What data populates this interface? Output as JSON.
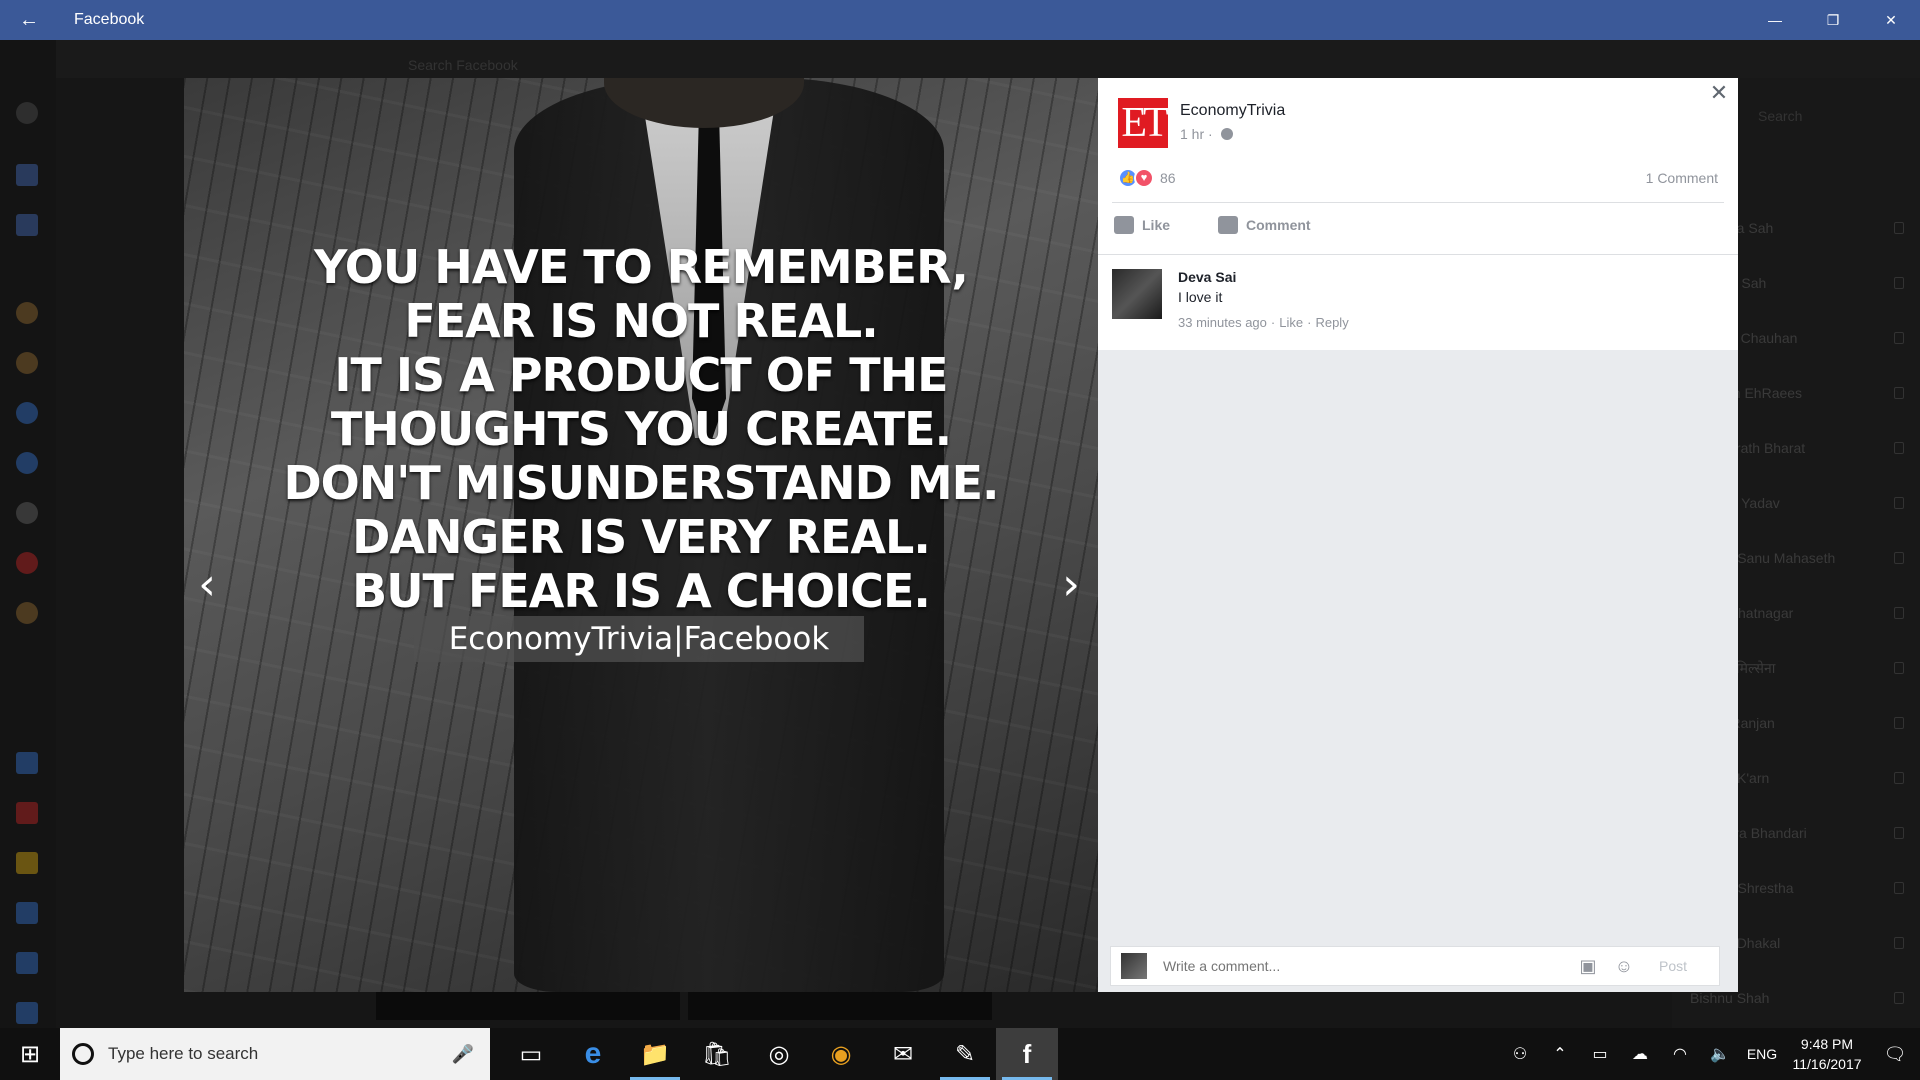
{
  "window": {
    "title": "Facebook",
    "back_glyph": "←",
    "minimize_glyph": "—",
    "restore_glyph": "❐",
    "close_glyph": "✕"
  },
  "background": {
    "search_placeholder": "Search Facebook",
    "right_search": "Search",
    "contacts": [
      "Priyanka Sah",
      "Krishna Sah",
      "Aayush Chauhan",
      "ItsNavin EhRaees",
      "Ah Bharath Bharat",
      "Nishant Yadav",
      "Vikram Sanu Mahaseth",
      "Vibek Bhatnagar",
      "आयुष तिमिल्सेना",
      "Rahul Ranjan",
      "A'Yush K'arn",
      "Rabindra Bhandari",
      "Angela Shrestha",
      "Sachin Dhakal",
      "Bishnu Shah"
    ]
  },
  "viewer": {
    "prev_glyph": "‹",
    "next_glyph": "›",
    "quote_lines": [
      "YOU HAVE TO REMEMBER,",
      "FEAR IS NOT REAL.",
      "IT IS A PRODUCT OF THE",
      "THOUGHTS YOU CREATE.",
      "DON'T MISUNDERSTAND ME.",
      "DANGER IS VERY REAL.",
      "BUT FEAR IS A CHOICE."
    ],
    "watermark": "EconomyTrivia|Facebook"
  },
  "post": {
    "logo_text": "ET",
    "page_name": "EconomyTrivia",
    "time": "1 hr ·",
    "reaction_count": "86",
    "comment_count": "1 Comment",
    "like_label": "Like",
    "comment_label": "Comment",
    "close_glyph": "✕",
    "comments": [
      {
        "author": "Deva Sai",
        "text": "I love it",
        "time": "33 minutes ago",
        "like": "Like",
        "reply": "Reply"
      }
    ],
    "compose_placeholder": "Write a comment...",
    "post_label": "Post",
    "photo_icon_glyph": "▣",
    "emoji_icon_glyph": "☺"
  },
  "taskbar": {
    "start_glyph": "⊞",
    "search_placeholder": "Type here to search",
    "mic_glyph": "🎤",
    "apps": [
      {
        "name": "task-view",
        "glyph": "▭",
        "active": false
      },
      {
        "name": "edge",
        "glyph": "e",
        "active": false
      },
      {
        "name": "file-explorer",
        "glyph": "📁",
        "active": true
      },
      {
        "name": "store",
        "glyph": "🛍",
        "active": false
      },
      {
        "name": "groove-music",
        "glyph": "◎",
        "active": false
      },
      {
        "name": "chrome",
        "glyph": "◉",
        "active": false
      },
      {
        "name": "mail",
        "glyph": "✉",
        "active": false
      },
      {
        "name": "pen",
        "glyph": "✎",
        "active": true
      },
      {
        "name": "facebook",
        "glyph": "f",
        "active": true
      }
    ],
    "language": "ENG",
    "time": "9:48 PM",
    "date": "11/16/2017"
  }
}
